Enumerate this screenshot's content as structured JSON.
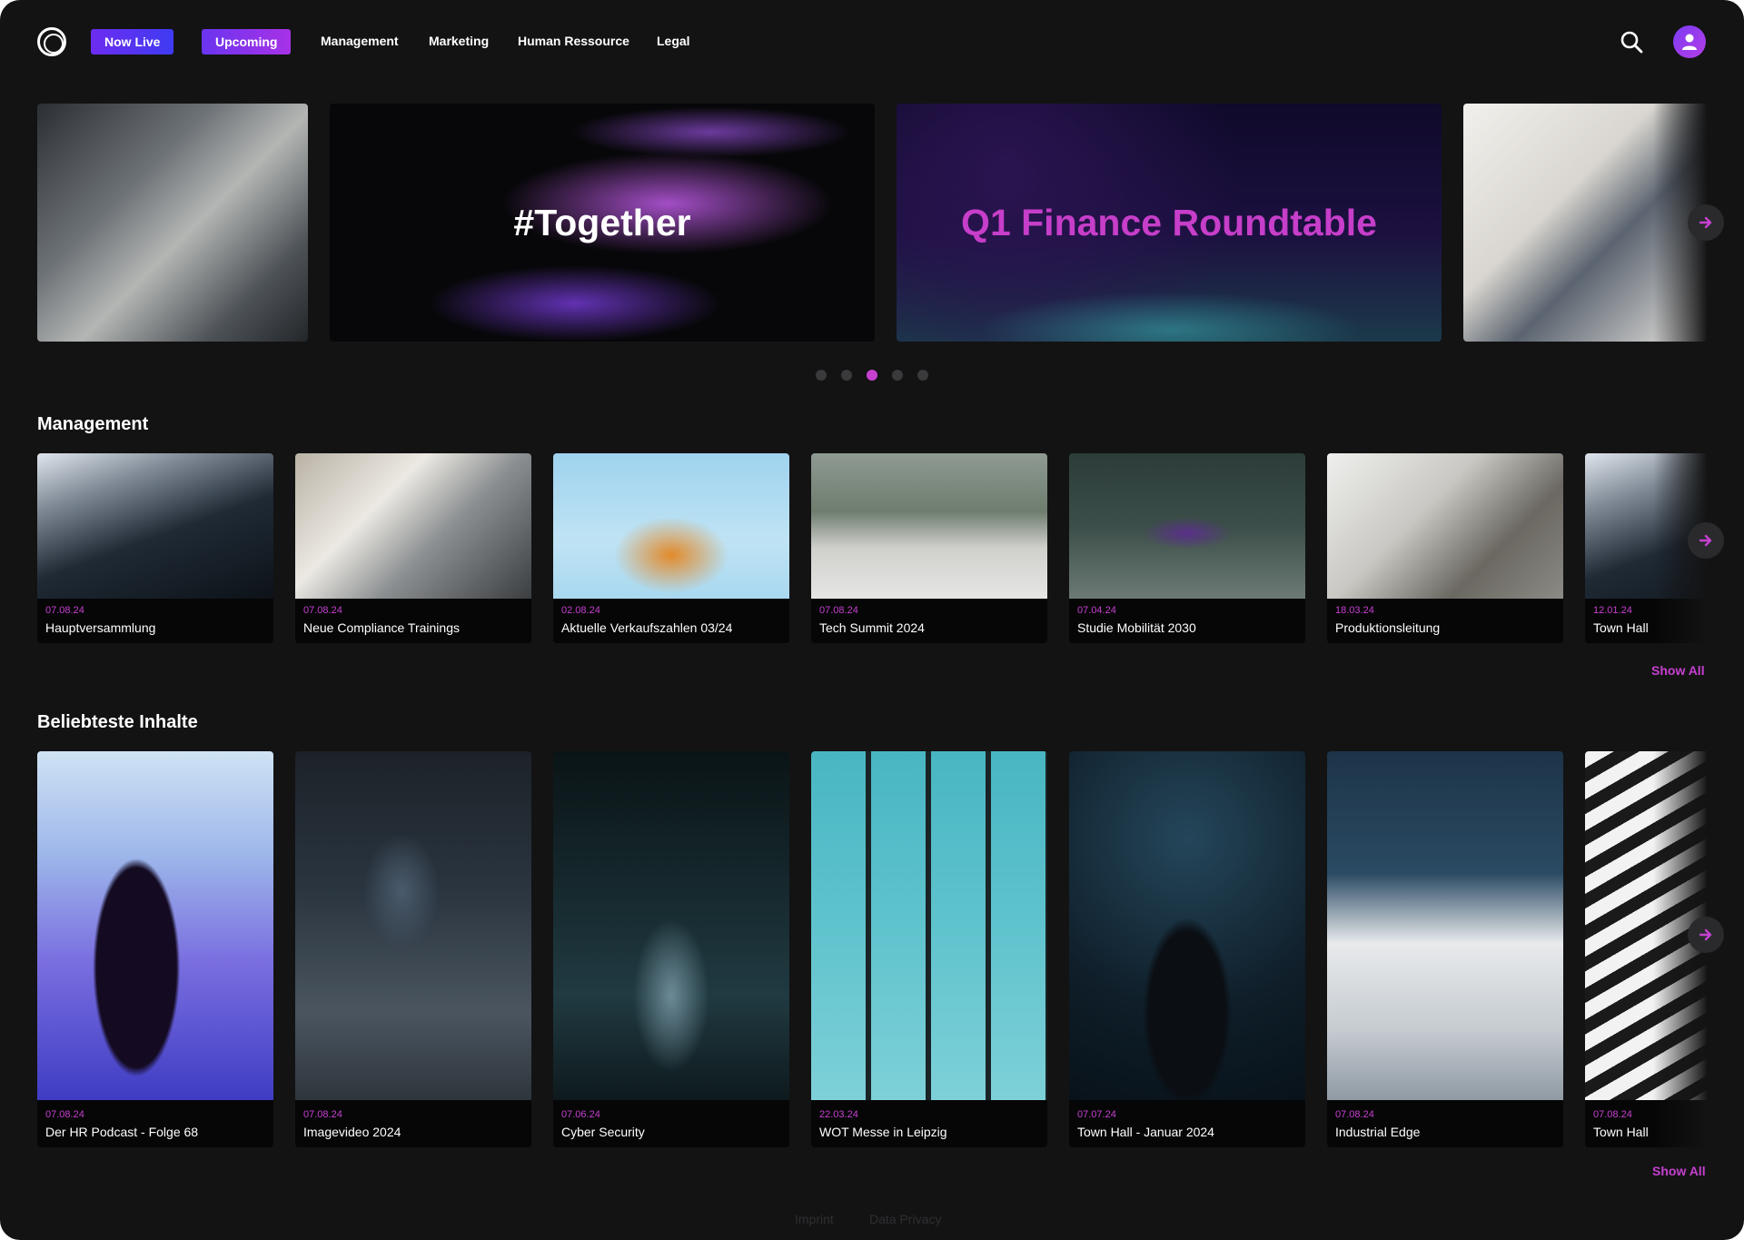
{
  "header": {
    "now_live": "Now Live",
    "upcoming": "Upcoming",
    "nav": [
      "Management",
      "Marketing",
      "Human Ressource",
      "Legal"
    ]
  },
  "hero": {
    "slides": [
      {
        "title": ""
      },
      {
        "title": "#Together"
      },
      {
        "title": "Q1 Finance Roundtable"
      },
      {
        "title": ""
      }
    ],
    "dots": 5,
    "active_dot": 3
  },
  "management": {
    "title": "Management",
    "show_all": "Show All",
    "items": [
      {
        "date": "07.08.24",
        "title": "Hauptversammlung"
      },
      {
        "date": "07.08.24",
        "title": "Neue Compliance Trainings"
      },
      {
        "date": "02.08.24",
        "title": "Aktuelle Verkaufszahlen 03/24"
      },
      {
        "date": "07.08.24",
        "title": "Tech Summit 2024"
      },
      {
        "date": "07.04.24",
        "title": "Studie Mobilität 2030"
      },
      {
        "date": "18.03.24",
        "title": "Produktionsleitung"
      },
      {
        "date": "12.01.24",
        "title": "Town Hall"
      }
    ]
  },
  "popular": {
    "title": "Beliebteste Inhalte",
    "show_all": "Show All",
    "items": [
      {
        "date": "07.08.24",
        "title": "Der HR Podcast - Folge 68"
      },
      {
        "date": "07.08.24",
        "title": "Imagevideo 2024"
      },
      {
        "date": "07.06.24",
        "title": "Cyber Security"
      },
      {
        "date": "22.03.24",
        "title": "WOT Messe in Leipzig"
      },
      {
        "date": "07.07.24",
        "title": "Town Hall - Januar 2024"
      },
      {
        "date": "07.08.24",
        "title": "Industrial Edge"
      },
      {
        "date": "07.08.24",
        "title": "Town Hall"
      }
    ]
  },
  "footer": {
    "imprint": "Imprint",
    "privacy": "Data Privacy"
  },
  "colors": {
    "background": "#131314",
    "accent": "#c640d0",
    "now_live": "#4b36f2",
    "upcoming": "#8a35ea"
  },
  "icons": [
    "logo-icon",
    "search-icon",
    "user-icon",
    "arrow-right-icon"
  ]
}
